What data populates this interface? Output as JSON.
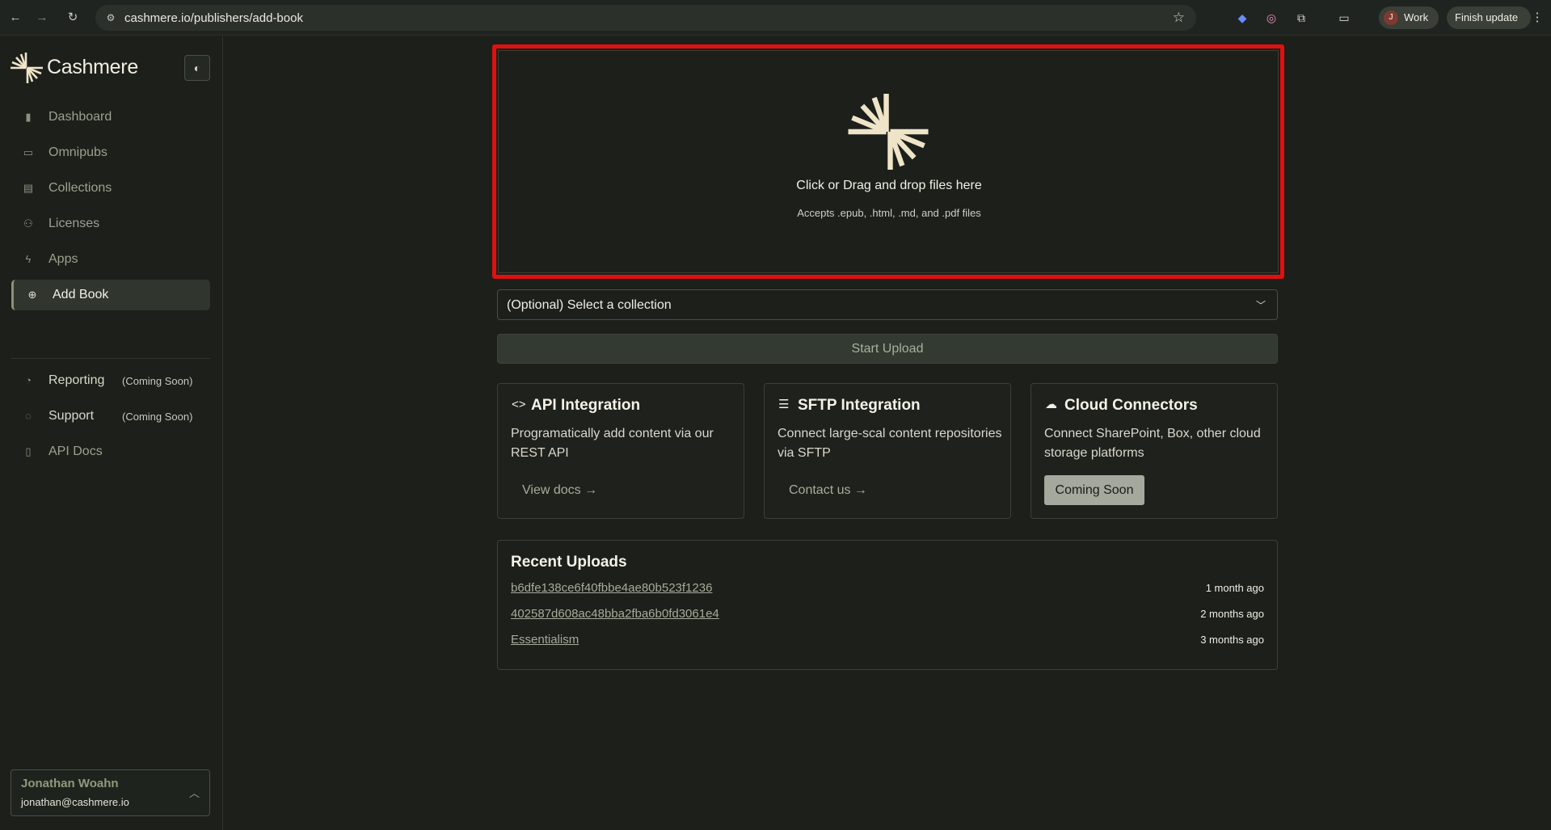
{
  "browser": {
    "url": "cashmere.io/publishers/add-book",
    "profile_initial": "J",
    "profile_label": "Work",
    "update_label": "Finish update"
  },
  "sidebar": {
    "brand": "Cashmere",
    "items": [
      {
        "label": "Dashboard",
        "icon": "bar-chart-icon"
      },
      {
        "label": "Omnipubs",
        "icon": "book-icon"
      },
      {
        "label": "Collections",
        "icon": "archive-icon"
      },
      {
        "label": "Licenses",
        "icon": "users-icon"
      },
      {
        "label": "Apps",
        "icon": "bolt-icon"
      },
      {
        "label": "Add Book",
        "icon": "plus-circle-icon",
        "active": true
      }
    ],
    "secondary_items": [
      {
        "label": "Reporting",
        "note": "(Coming Soon)",
        "icon": "pie-chart-icon"
      },
      {
        "label": "Support",
        "note": "(Coming Soon)",
        "icon": "chat-icon"
      },
      {
        "label": "API Docs",
        "icon": "file-code-icon"
      }
    ],
    "user": {
      "name": "Jonathan Woahn",
      "email": "jonathan@cashmere.io"
    }
  },
  "upload": {
    "title": "Click or Drag and drop files here",
    "subtitle": "Accepts .epub, .html, .md, and .pdf files",
    "collection_placeholder": "(Optional) Select a collection",
    "start_button": "Start Upload"
  },
  "integrations": [
    {
      "title": "API Integration",
      "description": "Programatically add content via our REST API",
      "action": "View docs →",
      "icon": "code-icon"
    },
    {
      "title": "SFTP Integration",
      "description": "Connect large-scal content repositories via SFTP",
      "action": "Contact us →",
      "icon": "server-icon"
    },
    {
      "title": "Cloud Connectors",
      "description": "Connect SharePoint, Box, other cloud storage platforms",
      "action": "Coming Soon",
      "icon": "cloud-icon"
    }
  ],
  "recent_uploads": {
    "title": "Recent Uploads",
    "items": [
      {
        "name": "b6dfe138ce6f40fbbe4ae80b523f1236",
        "time": "1 month ago"
      },
      {
        "name": "402587d608ac48bba2fba6b0fd3061e4",
        "time": "2 months ago"
      },
      {
        "name": "Essentialism",
        "time": "3 months ago"
      }
    ]
  },
  "colors": {
    "background": "#1c1f1a",
    "highlight": "#e01010",
    "accent": "#8f9a7d",
    "logo": "#efe4c8"
  }
}
